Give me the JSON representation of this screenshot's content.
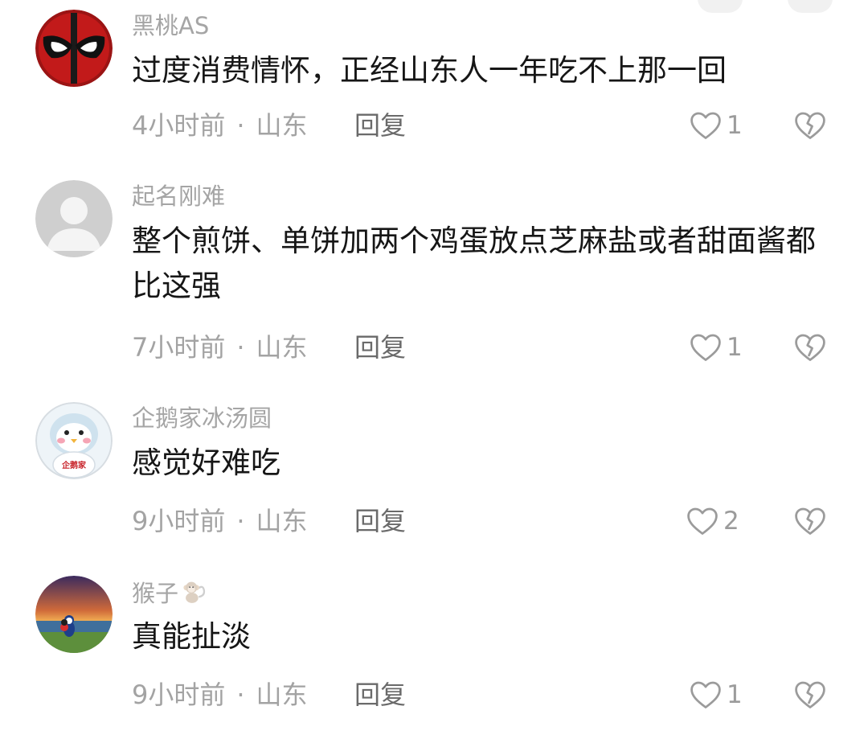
{
  "comments": [
    {
      "username": "黑桃AS",
      "avatar_icon": "masked-hero-avatar",
      "content": "过度消费情怀，正经山东人一年吃不上那一回",
      "time": "4小时前",
      "location": "山东",
      "reply_label": "回复",
      "likes": "1"
    },
    {
      "username": "起名刚难",
      "avatar_icon": "default-person-avatar",
      "content": "整个煎饼、单饼加两个鸡蛋放点芝麻盐或者甜面酱都比这强",
      "time": "7小时前",
      "location": "山东",
      "reply_label": "回复",
      "likes": "1"
    },
    {
      "username": "企鹅家冰汤圆",
      "avatar_icon": "penguin-avatar",
      "avatar_text": "企鹅家",
      "content": "感觉好难吃",
      "time": "9小时前",
      "location": "山东",
      "reply_label": "回复",
      "likes": "2"
    },
    {
      "username": "猴子",
      "avatar_icon": "sunset-scene-avatar",
      "username_badge_icon": "monkey-icon",
      "content": "真能扯淡",
      "time": "9小时前",
      "location": "山东",
      "reply_label": "回复",
      "likes": "1"
    }
  ],
  "meta_separator": "·",
  "icons": {
    "like": "heart-outline-icon",
    "dislike": "broken-heart-icon"
  },
  "colors": {
    "username": "#a5a5a5",
    "content": "#161616",
    "meta": "#a3a3a3",
    "icon": "#9b9b9b"
  }
}
